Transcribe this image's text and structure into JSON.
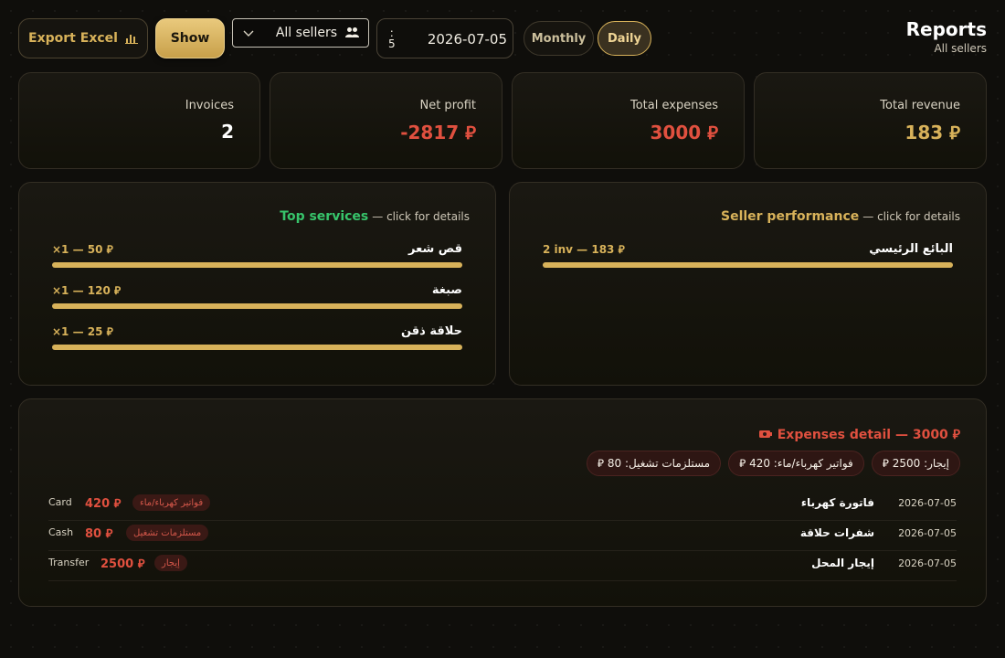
{
  "header": {
    "title": "Reports",
    "subtitle": "All sellers"
  },
  "toolbar": {
    "export_label": "Export Excel",
    "show_label": "Show",
    "seller_select": "All sellers",
    "date_small_top": ":",
    "date_small_bottom": "5",
    "date_value": "2026-07-05",
    "period_monthly": "Monthly",
    "period_daily": "Daily",
    "active_period": "Daily"
  },
  "currency_symbol": "⃁",
  "stats": [
    {
      "label": "Total revenue",
      "value": "183 ⃁",
      "color": "#d8b25a"
    },
    {
      "label": "Total expenses",
      "value": "3000 ⃁",
      "color": "#e0503f"
    },
    {
      "label": "Net profit",
      "value": "-2817 ⃁",
      "color": "#e0503f"
    },
    {
      "label": "Invoices",
      "value": "2",
      "color": "#ffffff"
    }
  ],
  "top_services": {
    "title": "Top services",
    "hint": "— click for details",
    "items": [
      {
        "name": "قص شعر",
        "meta": "×1 — 50 ⃁",
        "fill": 1.0
      },
      {
        "name": "صبغة",
        "meta": "×1 — 120 ⃁",
        "fill": 1.0
      },
      {
        "name": "حلاقة ذقن",
        "meta": "×1 — 25 ⃁",
        "fill": 1.0
      }
    ]
  },
  "seller_performance": {
    "title": "Seller performance",
    "hint": "— click for details",
    "items": [
      {
        "name": "البائع الرئيسي",
        "meta": "2 inv — 183 ⃁",
        "fill": 1.0
      }
    ]
  },
  "expenses": {
    "title": "Expenses detail — 3000 ⃁",
    "chips": [
      "إيجار: 2500 ⃁",
      "فواتير كهرباء/ماء: 420 ⃁",
      "مستلزمات تشغيل: 80 ⃁"
    ],
    "rows": [
      {
        "date": "2026-07-05",
        "desc": "فاتورة كهرباء",
        "category": "فواتير كهرباء/ماء",
        "amount": "420 ⃁",
        "method": "Card"
      },
      {
        "date": "2026-07-05",
        "desc": "شفرات حلاقة",
        "category": "مستلزمات تشغيل",
        "amount": "80 ⃁",
        "method": "Cash"
      },
      {
        "date": "2026-07-05",
        "desc": "إيجار المحل",
        "category": "إيجار",
        "amount": "2500 ⃁",
        "method": "Transfer"
      }
    ]
  },
  "colors": {
    "gold": "#d8b25a",
    "red": "#e0503f",
    "green": "#37c46b",
    "background": "#0f0e0b"
  }
}
